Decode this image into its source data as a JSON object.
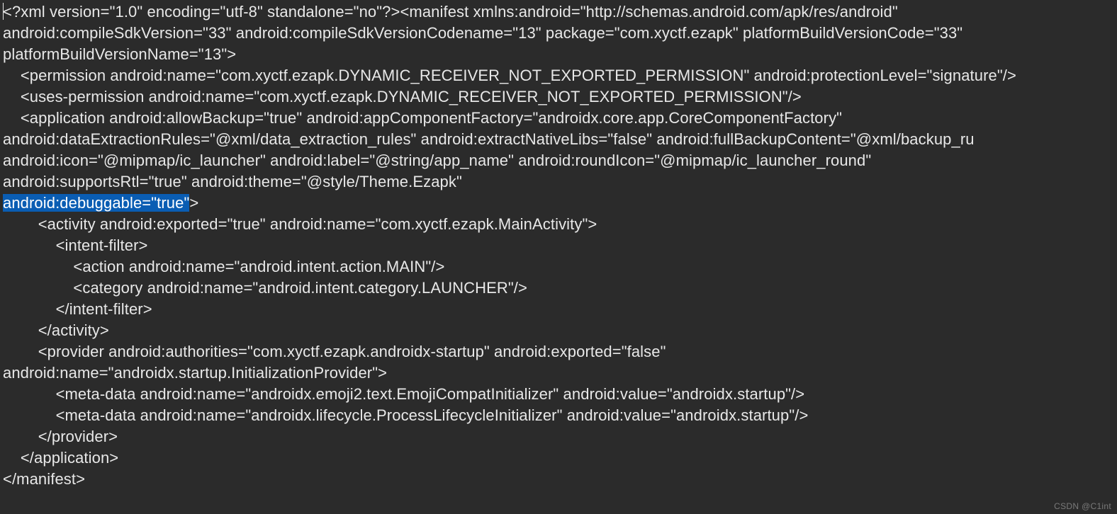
{
  "code": {
    "l01a": "<?xml version=\"1.0\" encoding=\"utf-8\" standalone=\"no\"?><manifest xmlns:android=\"http://schemas.android.com/apk/res/android\" ",
    "l01b": "android:compileSdkVersion=\"33\" android:compileSdkVersionCodename=\"13\" package=\"com.xyctf.ezapk\" platformBuildVersionCode=\"33\" ",
    "l01c": "platformBuildVersionName=\"13\">",
    "l02": "    <permission android:name=\"com.xyctf.ezapk.DYNAMIC_RECEIVER_NOT_EXPORTED_PERMISSION\" android:protectionLevel=\"signature\"/>",
    "l03": "    <uses-permission android:name=\"com.xyctf.ezapk.DYNAMIC_RECEIVER_NOT_EXPORTED_PERMISSION\"/>",
    "l04a": "    <application android:allowBackup=\"true\" android:appComponentFactory=\"androidx.core.app.CoreComponentFactory\" ",
    "l04b": "android:dataExtractionRules=\"@xml/data_extraction_rules\" android:extractNativeLibs=\"false\" android:fullBackupContent=\"@xml/backup_ru",
    "l04c": "android:icon=\"@mipmap/ic_launcher\" android:label=\"@string/app_name\" android:roundIcon=\"@mipmap/ic_launcher_round\" ",
    "l04d": "android:supportsRtl=\"true\" android:theme=\"@style/Theme.Ezapk\"",
    "l04e_hl": "android:debuggable=\"true\"",
    "l04e_tail": ">",
    "l05": "        <activity android:exported=\"true\" android:name=\"com.xyctf.ezapk.MainActivity\">",
    "l06": "            <intent-filter>",
    "l07": "                <action android:name=\"android.intent.action.MAIN\"/>",
    "l08": "                <category android:name=\"android.intent.category.LAUNCHER\"/>",
    "l09": "            </intent-filter>",
    "l10": "        </activity>",
    "l11a": "        <provider android:authorities=\"com.xyctf.ezapk.androidx-startup\" android:exported=\"false\" ",
    "l11b": "android:name=\"androidx.startup.InitializationProvider\">",
    "l12": "            <meta-data android:name=\"androidx.emoji2.text.EmojiCompatInitializer\" android:value=\"androidx.startup\"/>",
    "l13": "            <meta-data android:name=\"androidx.lifecycle.ProcessLifecycleInitializer\" android:value=\"androidx.startup\"/>",
    "l14": "        </provider>",
    "l15": "    </application>",
    "l16": "</manifest>"
  },
  "watermark": "CSDN @C1int"
}
